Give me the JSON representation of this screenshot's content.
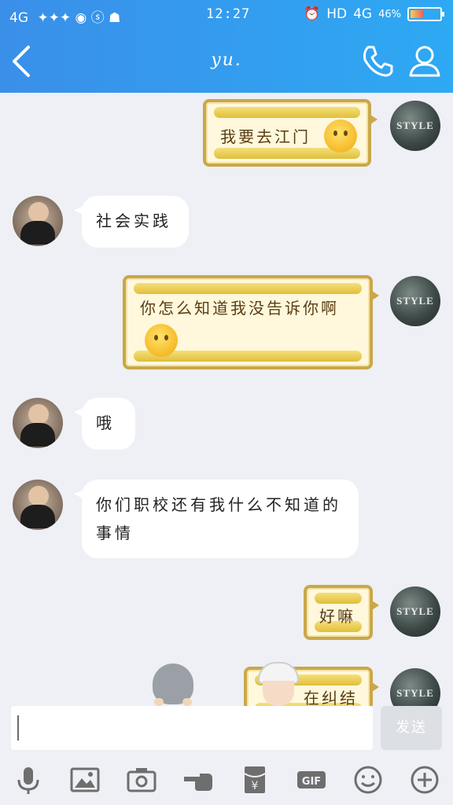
{
  "status_bar": {
    "signal_left": "4G",
    "time": "12:27",
    "hd": "HD",
    "network": "4G",
    "battery_text": "46%",
    "battery_level": 0.46
  },
  "header": {
    "title": "yu."
  },
  "messages": [
    {
      "from": "me",
      "text": "我要去江门"
    },
    {
      "from": "other",
      "text": "社会实践"
    },
    {
      "from": "me",
      "text": "你怎么知道我没告诉你啊"
    },
    {
      "from": "other",
      "text": "哦"
    },
    {
      "from": "other",
      "text": "你们职校还有我什么不知道的事情"
    },
    {
      "from": "me",
      "text": "好嘛"
    },
    {
      "from": "me",
      "text": "在纠结"
    }
  ],
  "my_avatar_text": "STYLE",
  "input": {
    "value": "",
    "send_label": "发送"
  },
  "colors": {
    "header_start": "#3a8fe9",
    "header_end": "#2ea9f3",
    "frame_gold": "#c9a74a",
    "background": "#eef0f5"
  },
  "toolbar_icons": [
    "microphone-icon",
    "image-icon",
    "camera-icon",
    "poke-icon",
    "red-packet-icon",
    "gif-icon",
    "emoji-icon",
    "plus-icon"
  ]
}
